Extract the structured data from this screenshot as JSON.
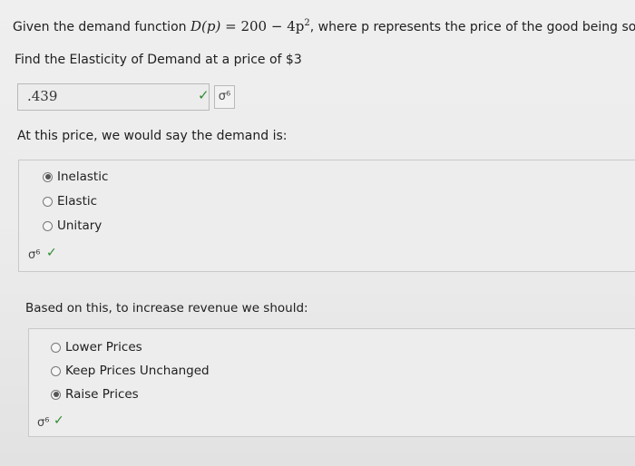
{
  "question1": {
    "prefix": "Given the demand function",
    "func_lhs": "D(p)",
    "func_eq": "=",
    "func_const": "200",
    "func_minus": "−",
    "func_term": "4p",
    "func_exp": "2",
    "suffix": ", where p represents the price of the good being sold,",
    "line2": "Find the Elasticity of Demand at a price of $3"
  },
  "answer1": {
    "value": ".439",
    "check_icon": "✓",
    "keypad_icon": "σ⁶"
  },
  "question2": {
    "prompt": "At this price, we would say the demand is:",
    "options": [
      "Inelastic",
      "Elastic",
      "Unitary"
    ],
    "selected": 0,
    "keypad_icon": "σ⁶",
    "check_icon": "✓"
  },
  "question3": {
    "prompt": "Based on this, to increase revenue we should:",
    "options": [
      "Lower Prices",
      "Keep Prices Unchanged",
      "Raise Prices"
    ],
    "selected": 2,
    "keypad_icon": "σ⁶",
    "check_icon": "✓"
  }
}
